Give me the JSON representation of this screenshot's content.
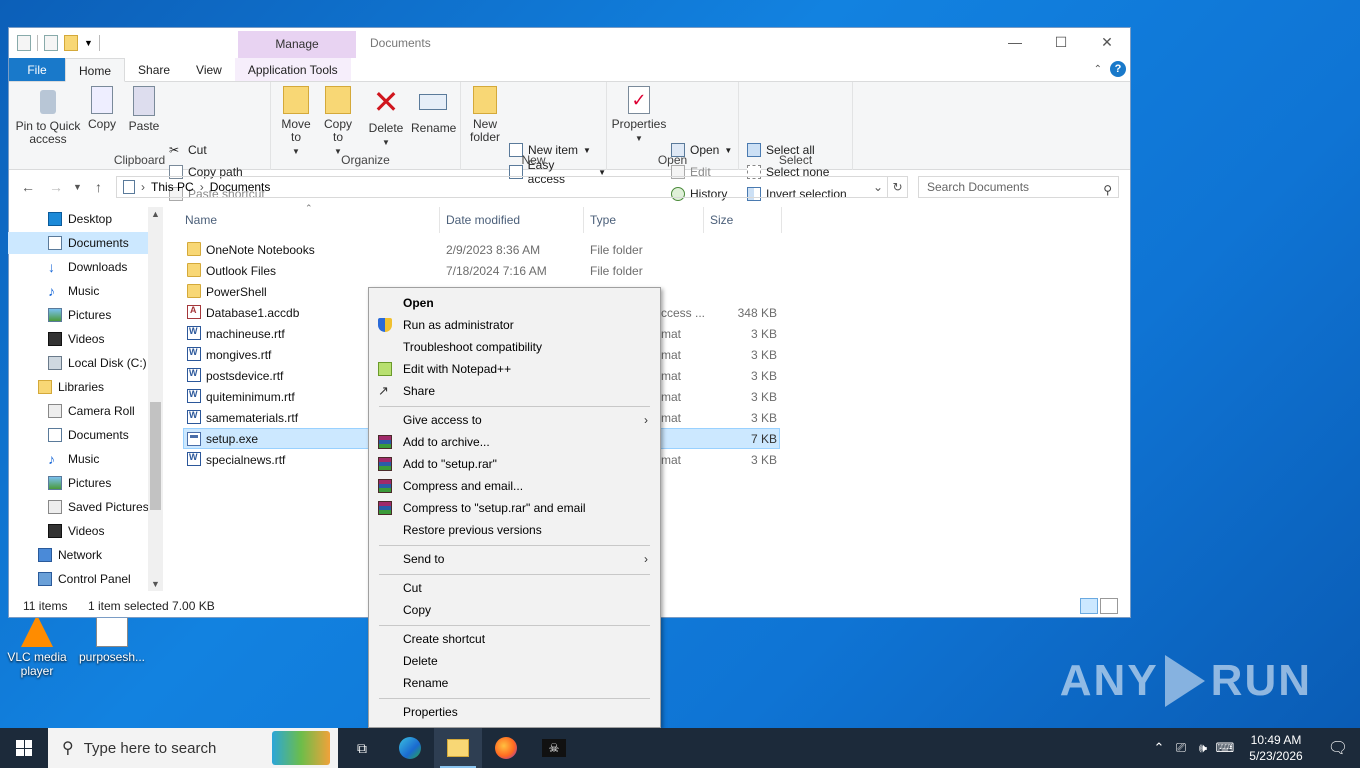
{
  "window": {
    "title": "Documents",
    "manage_tab": "Manage",
    "minimize": "—",
    "maximize": "☐",
    "close": "✕"
  },
  "tabs": {
    "file": "File",
    "home": "Home",
    "share": "Share",
    "view": "View",
    "app_tools": "Application Tools"
  },
  "ribbon": {
    "clipboard": {
      "label": "Clipboard",
      "pin": "Pin to Quick access",
      "copy": "Copy",
      "paste": "Paste",
      "cut": "Cut",
      "copy_path": "Copy path",
      "paste_shortcut": "Paste shortcut"
    },
    "organize": {
      "label": "Organize",
      "move_to": "Move to",
      "copy_to": "Copy to",
      "delete": "Delete",
      "rename": "Rename"
    },
    "new": {
      "label": "New",
      "new_folder": "New folder",
      "new_item": "New item",
      "easy_access": "Easy access"
    },
    "open": {
      "label": "Open",
      "properties": "Properties",
      "open": "Open",
      "edit": "Edit",
      "history": "History"
    },
    "select": {
      "label": "Select",
      "select_all": "Select all",
      "select_none": "Select none",
      "invert": "Invert selection"
    }
  },
  "address": {
    "crumb1": "This PC",
    "crumb2": "Documents",
    "search_placeholder": "Search Documents"
  },
  "nav": [
    {
      "label": "Desktop"
    },
    {
      "label": "Documents"
    },
    {
      "label": "Downloads"
    },
    {
      "label": "Music"
    },
    {
      "label": "Pictures"
    },
    {
      "label": "Videos"
    },
    {
      "label": "Local Disk (C:)"
    },
    {
      "label": "Libraries"
    },
    {
      "label": "Camera Roll"
    },
    {
      "label": "Documents"
    },
    {
      "label": "Music"
    },
    {
      "label": "Pictures"
    },
    {
      "label": "Saved Pictures"
    },
    {
      "label": "Videos"
    },
    {
      "label": "Network"
    },
    {
      "label": "Control Panel"
    }
  ],
  "columns": {
    "name": "Name",
    "date": "Date modified",
    "type": "Type",
    "size": "Size"
  },
  "files": [
    {
      "name": "OneNote Notebooks",
      "date": "2/9/2023 8:36 AM",
      "type": "File folder",
      "size": ""
    },
    {
      "name": "Outlook Files",
      "date": "7/18/2024 7:16 AM",
      "type": "File folder",
      "size": ""
    },
    {
      "name": "PowerShell",
      "date": "",
      "type": "",
      "size": ""
    },
    {
      "name": "Database1.accdb",
      "date": "",
      "type": "ccess ...",
      "size": "348 KB"
    },
    {
      "name": "machineuse.rtf",
      "date": "",
      "type": "mat",
      "size": "3 KB"
    },
    {
      "name": "mongives.rtf",
      "date": "",
      "type": "mat",
      "size": "3 KB"
    },
    {
      "name": "postsdevice.rtf",
      "date": "",
      "type": "mat",
      "size": "3 KB"
    },
    {
      "name": "quiteminimum.rtf",
      "date": "",
      "type": "mat",
      "size": "3 KB"
    },
    {
      "name": "samematerials.rtf",
      "date": "",
      "type": "mat",
      "size": "3 KB"
    },
    {
      "name": "setup.exe",
      "date": "",
      "type": "",
      "size": "7 KB"
    },
    {
      "name": "specialnews.rtf",
      "date": "",
      "type": "mat",
      "size": "3 KB"
    }
  ],
  "status": {
    "count": "11 items",
    "selected": "1 item selected  7.00 KB"
  },
  "context_menu": {
    "open": "Open",
    "run_admin": "Run as administrator",
    "troubleshoot": "Troubleshoot compatibility",
    "notepad": "Edit with Notepad++",
    "share": "Share",
    "give_access": "Give access to",
    "add_archive": "Add to archive...",
    "add_rar": "Add to \"setup.rar\"",
    "compress_email": "Compress and email...",
    "compress_rar_email": "Compress to \"setup.rar\" and email",
    "restore": "Restore previous versions",
    "send_to": "Send to",
    "cut": "Cut",
    "copy": "Copy",
    "create_shortcut": "Create shortcut",
    "delete": "Delete",
    "rename": "Rename",
    "properties": "Properties"
  },
  "desktop": {
    "vlc": "VLC media player",
    "purpose": "purposesh..."
  },
  "watermark": {
    "left": "ANY",
    "right": "RUN"
  },
  "taskbar": {
    "search_placeholder": "Type here to search",
    "time": "10:49 AM",
    "date": "5/23/2026"
  },
  "colors": {
    "accent": "#1979ca",
    "selection": "#cce8ff",
    "manage_tab": "#e8d3f2",
    "taskbar": "#1c2a3a"
  }
}
